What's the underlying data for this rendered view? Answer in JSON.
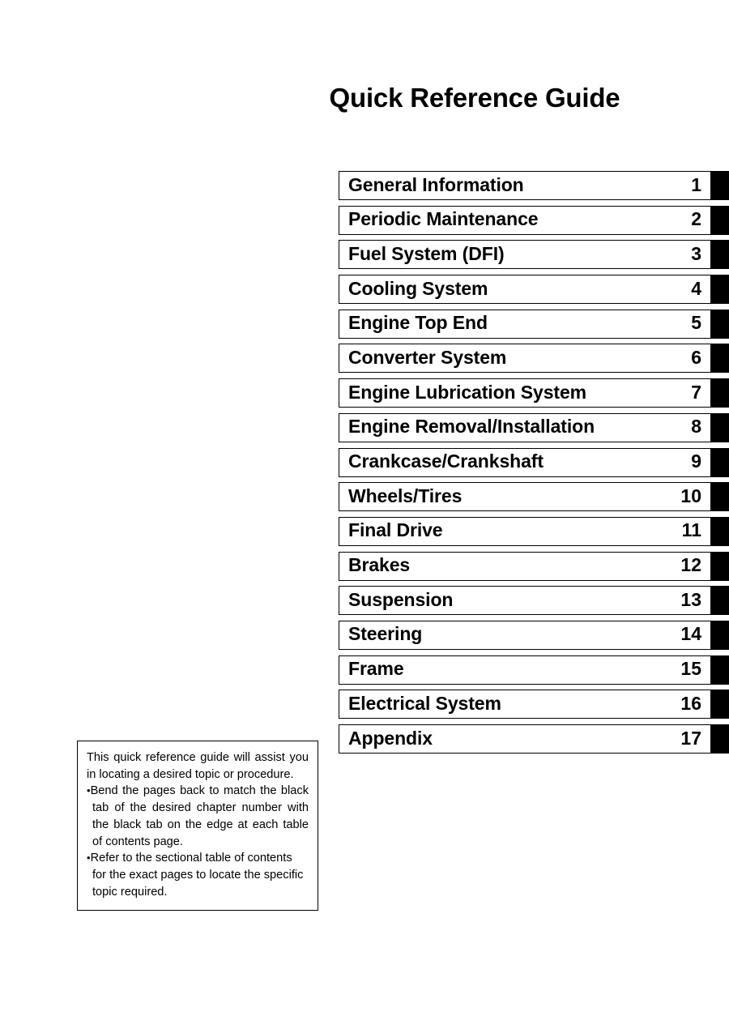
{
  "document": {
    "title": "Quick Reference Guide"
  },
  "chapters": [
    {
      "label": "General Information",
      "number": "1"
    },
    {
      "label": "Periodic Maintenance",
      "number": "2"
    },
    {
      "label": "Fuel System (DFI)",
      "number": "3"
    },
    {
      "label": "Cooling System",
      "number": "4"
    },
    {
      "label": "Engine Top End",
      "number": "5"
    },
    {
      "label": "Converter System",
      "number": "6"
    },
    {
      "label": "Engine Lubrication System",
      "number": "7"
    },
    {
      "label": "Engine Removal/Installation",
      "number": "8"
    },
    {
      "label": "Crankcase/Crankshaft",
      "number": "9"
    },
    {
      "label": "Wheels/Tires",
      "number": "10"
    },
    {
      "label": "Final Drive",
      "number": "11"
    },
    {
      "label": "Brakes",
      "number": "12"
    },
    {
      "label": "Suspension",
      "number": "13"
    },
    {
      "label": "Steering",
      "number": "14"
    },
    {
      "label": "Frame",
      "number": "15"
    },
    {
      "label": "Electrical System",
      "number": "16"
    },
    {
      "label": "Appendix",
      "number": "17"
    }
  ],
  "note": {
    "intro": "This quick reference guide will assist you in locating a desired topic or procedure.",
    "bullet_glyph": "•",
    "bullets": [
      "Bend the pages back to match the black tab of the desired chapter number with the black tab on the edge at each table of contents page.",
      "Refer to the sectional table of contents for the exact pages to locate the specific topic required."
    ]
  },
  "colors": {
    "ink": "#000000",
    "paper": "#ffffff",
    "tab": "#000000"
  }
}
